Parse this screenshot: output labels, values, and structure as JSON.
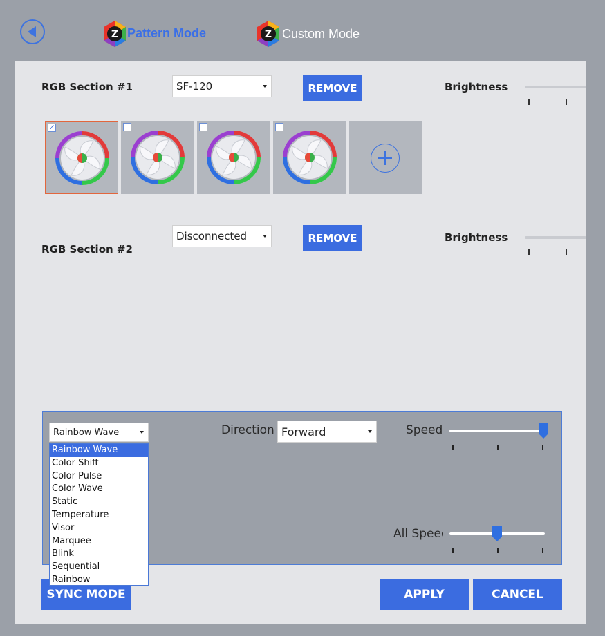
{
  "header": {
    "tabs": [
      {
        "label": "Pattern Mode",
        "active": true
      },
      {
        "label": "Custom Mode",
        "active": false
      }
    ]
  },
  "sections": [
    {
      "title": "RGB Section #1",
      "device": "SF-120",
      "remove_label": "REMOVE",
      "brightness_label": "Brightness",
      "fans": [
        {
          "checked": true,
          "check_glyph": "✓"
        },
        {
          "checked": false,
          "check_glyph": ""
        },
        {
          "checked": false,
          "check_glyph": ""
        },
        {
          "checked": false,
          "check_glyph": ""
        }
      ]
    },
    {
      "title": "RGB Section #2",
      "device": "Disconnected",
      "remove_label": "REMOVE",
      "brightness_label": "Brightness"
    }
  ],
  "mode": {
    "effect_selected": "Rainbow Wave",
    "effect_options": [
      "Rainbow Wave",
      "Color Shift",
      "Color Pulse",
      "Color Wave",
      "Static",
      "Temperature",
      "Visor",
      "Marquee",
      "Blink",
      "Sequential",
      "Rainbow"
    ],
    "direction_label": "Direction",
    "direction_value": "Forward",
    "speed_label": "Speed",
    "speed_value": 1.0,
    "all_speed_label": "All Speed",
    "all_speed_value": 0.5
  },
  "footer": {
    "sync_label": "SYNC MODE",
    "apply_label": "APPLY",
    "cancel_label": "CANCEL"
  },
  "colors": {
    "accent": "#3b6ce0",
    "selected_border": "#e2663d"
  },
  "icons": {
    "back": "back-arrow-icon",
    "logo": "z-logo-icon",
    "add": "add-fan-icon",
    "fan": "rgb-fan-icon"
  }
}
